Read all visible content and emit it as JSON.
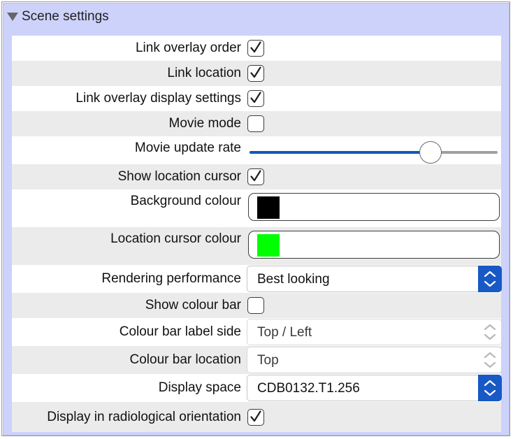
{
  "panel": {
    "title": "Scene settings"
  },
  "rows": [
    {
      "label": "Link overlay order",
      "control": "checkbox",
      "checked": true
    },
    {
      "label": "Link location",
      "control": "checkbox",
      "checked": true
    },
    {
      "label": "Link overlay display settings",
      "control": "checkbox",
      "checked": true
    },
    {
      "label": "Movie mode",
      "control": "checkbox",
      "checked": false
    },
    {
      "label": "Movie update rate",
      "control": "slider",
      "fraction": 0.73
    },
    {
      "label": "Show location cursor",
      "control": "checkbox",
      "checked": true
    },
    {
      "label": "Background colour",
      "control": "colour",
      "colour": "#000000"
    },
    {
      "label": "Location cursor colour",
      "control": "colour",
      "colour": "#00ff00"
    },
    {
      "label": "Rendering performance",
      "control": "select",
      "value": "Best looking",
      "enabled": true
    },
    {
      "label": "Show colour bar",
      "control": "checkbox",
      "checked": false
    },
    {
      "label": "Colour bar label side",
      "control": "select",
      "value": "Top / Left",
      "enabled": false
    },
    {
      "label": "Colour bar location",
      "control": "select",
      "value": "Top",
      "enabled": false
    },
    {
      "label": "Display space",
      "control": "select",
      "value": "CDB0132.T1.256",
      "enabled": true
    },
    {
      "label": "Display in radiological orientation",
      "control": "checkbox",
      "checked": true
    }
  ],
  "colors": {
    "panel_background": "#cdd2fa",
    "accent_blue": "#1859c5",
    "slider_fill": "#0f5bb5"
  }
}
